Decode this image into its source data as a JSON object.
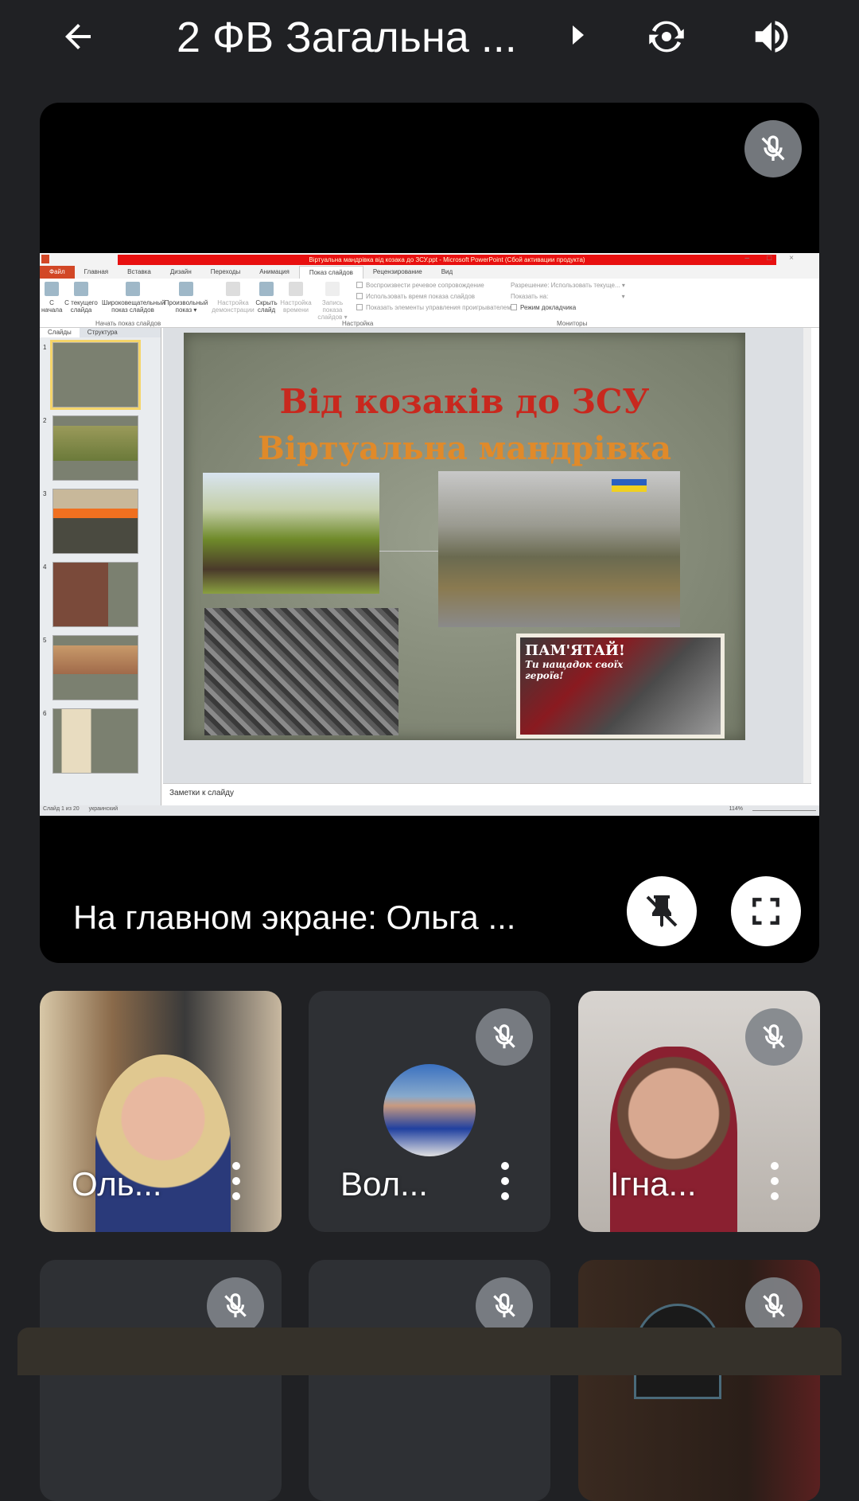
{
  "header": {
    "title": "2 ФВ Загальна ...",
    "back_icon": "arrow-left-icon",
    "switch_camera_icon": "camera-switch-icon",
    "audio_icon": "volume-icon"
  },
  "presentation": {
    "caption": "На главном экране: Ольга ...",
    "ppt": {
      "window_title": "Віртуальна мандрівка від козака до ЗСУ.ppt - Microsoft PowerPoint (Сбой активации продукта)",
      "tabs": [
        "Файл",
        "Главная",
        "Вставка",
        "Дизайн",
        "Переходы",
        "Анимация",
        "Показ слайдов",
        "Рецензирование",
        "Вид"
      ],
      "ribbon": {
        "from_start": "С начала",
        "from_current": "С текущего слайда",
        "broadcast": "Широковещательный показ слайдов",
        "custom": "Произвольный показ ▾",
        "group_start": "Начать показ слайдов",
        "setup": "Настройка демонстрации",
        "hide": "Скрыть слайд",
        "timing": "Настройка времени",
        "record": "Запись показа слайдов ▾",
        "chk1": "Воспроизвести речевое сопровождение",
        "chk2": "Использовать время показа слайдов",
        "chk3": "Показать элементы управления проигрывателем",
        "group_setup": "Настройка",
        "resolution_label": "Разрешение:",
        "resolution_value": "Использовать текуще...",
        "show_on_label": "Показать на:",
        "presenter_view": "Режим докладчика",
        "group_monitors": "Мониторы"
      },
      "pane_tabs": [
        "Слайды",
        "Структура"
      ],
      "thumbnails": [
        "1",
        "2",
        "3",
        "4",
        "5",
        "6"
      ],
      "slide": {
        "title": "Від козаків до ЗСУ",
        "subtitle": "Віртуальна мандрівка",
        "poster_line1": "ПАМ'ЯТАЙ!",
        "poster_line2": "Ти нащадок своїх",
        "poster_line3": "героїв!"
      },
      "notes_placeholder": "Заметки к слайду",
      "status": {
        "slide": "Слайд 1 из 20",
        "language": "украинский",
        "zoom": "114%"
      }
    }
  },
  "participants": [
    {
      "name": "Оль...",
      "muted": false
    },
    {
      "name": "Вол...",
      "muted": true
    },
    {
      "name": "Ігна...",
      "muted": true
    }
  ],
  "colors": {
    "background": "#202124",
    "tile": "#2e3034",
    "slide_title": "#c8281e",
    "slide_subtitle": "#e08a2a"
  }
}
